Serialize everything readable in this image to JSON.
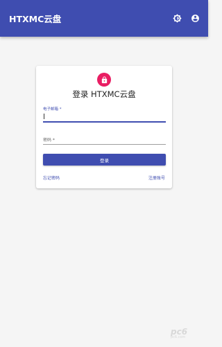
{
  "appbar": {
    "title": "HTXMC云盘",
    "theme_icon": "brightness-icon",
    "account_icon": "account-circle-icon",
    "color": "#3f4db0"
  },
  "login": {
    "lock_icon": "lock-icon",
    "lock_color": "#e91e63",
    "title": "登录 HTXMC云盘",
    "email_label": "电子邮箱 *",
    "email_value": "",
    "password_label": "密码 *",
    "password_value": "",
    "submit_label": "登录",
    "forgot_link": "忘记密码",
    "register_link": "注册账号"
  },
  "watermark": {
    "text": "pc6",
    "sub": "pc6.com"
  }
}
